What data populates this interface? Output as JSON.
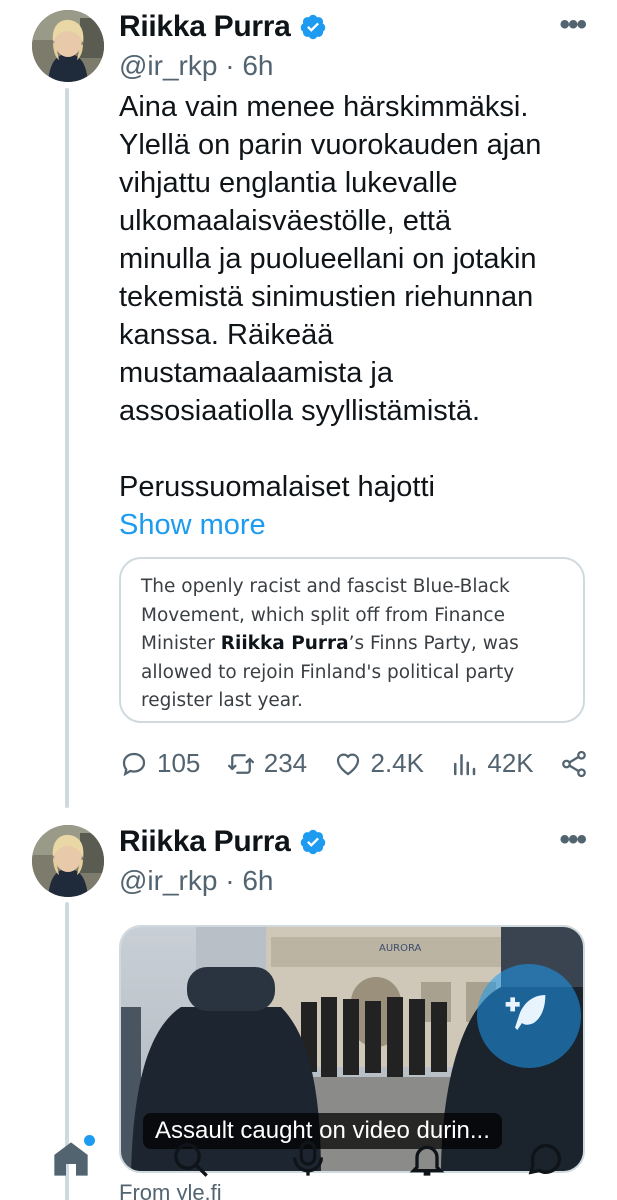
{
  "tweets": [
    {
      "author_name": "Riikka Purra",
      "handle_time": "@ir_rkp · 6h",
      "text_paragraph_1": "Aina vain menee härskimmäksi.\nYlellä on parin vuorokauden ajan\nvihjattu englantia lukevalle\nulkomaalaisväestölle, että\nminulla ja puolueellani on jotakin\ntekemistä sinimustien riehunnan\nkanssa. Räikeää\nmustamaalaamista ja\nassosiaatiolla syyllistämistä.",
      "text_paragraph_2": "Perussuomalaiset hajotti",
      "show_more": "Show more",
      "quote": {
        "before": "The openly racist and fascist Blue-Black Movement, which split off from Finance Minister ",
        "bold": "Riikka Purra",
        "after": "’s Finns Party, was allowed to rejoin Finland's political party register last year."
      },
      "stats": {
        "replies": "105",
        "retweets": "234",
        "likes": "2.4K",
        "views": "42K"
      }
    },
    {
      "author_name": "Riikka Purra",
      "handle_time": "@ir_rkp · 6h",
      "media_caption": "Assault caught on video durin...",
      "source": "From yle.fi",
      "media_sign": "AURORA"
    }
  ],
  "icons": {
    "verified": "verified-badge-icon",
    "reply": "reply-icon",
    "retweet": "retweet-icon",
    "like": "heart-icon",
    "views": "views-icon",
    "share": "share-icon",
    "compose": "compose-icon",
    "nav": [
      "home-icon",
      "search-icon",
      "spaces-icon",
      "notifications-icon",
      "messages-icon"
    ]
  },
  "colors": {
    "accent": "#1d9bf0",
    "text": "#0f1419",
    "muted": "#536471",
    "border": "#cfd9de"
  }
}
